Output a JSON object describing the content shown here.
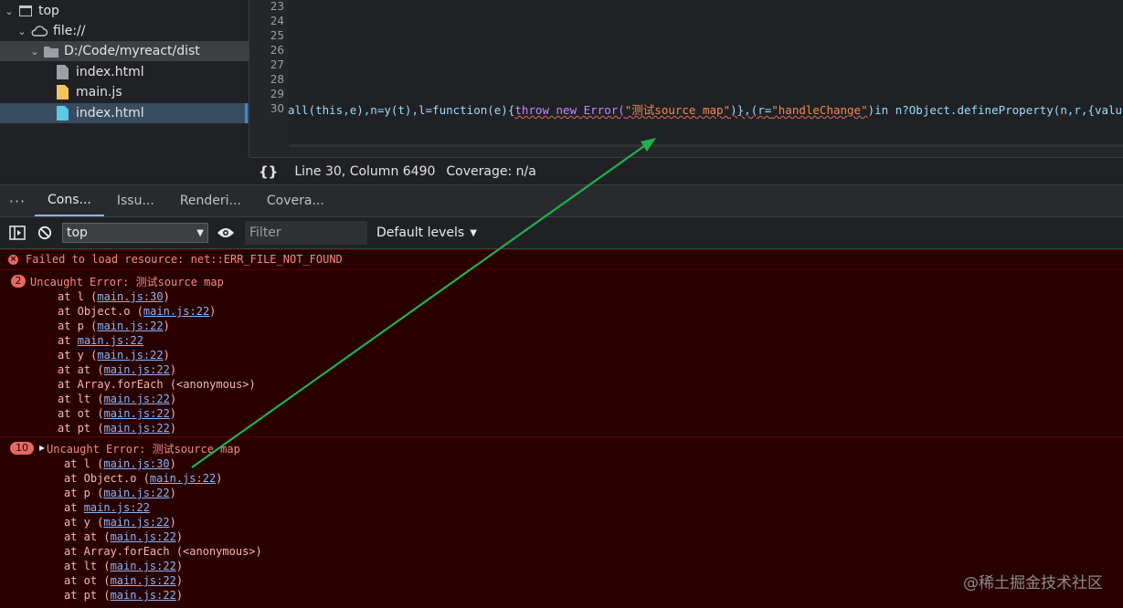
{
  "tree": {
    "items": [
      {
        "label": "top",
        "icon": "frame-icon",
        "chev": "⌄"
      },
      {
        "label": "file://",
        "icon": "cloud-icon",
        "chev": "⌄"
      },
      {
        "label": "D:/Code/myreact/dist",
        "icon": "folder-icon",
        "chev": "⌄"
      },
      {
        "label": "index.html",
        "icon": "file-icon"
      },
      {
        "label": "main.js",
        "icon": "js-file-icon"
      },
      {
        "label": "index.html",
        "icon": "html-file-icon"
      }
    ]
  },
  "editor": {
    "line_numbers": [
      "23",
      "24",
      "25",
      "26",
      "27",
      "28",
      "29",
      "30"
    ],
    "code_parts": [
      "all(this,e),n=y(t),l=function(e){",
      "throw new Error(",
      "\"测试source map\"",
      ")},(r=",
      "\"handleChange\"",
      ")in n?Object.defineProperty(n,r,{value"
    ]
  },
  "status": {
    "braces": "{}",
    "position": "Line 30, Column 6490",
    "coverage": "Coverage: n/a"
  },
  "tabs": {
    "more": "⋮",
    "items": [
      "Cons...",
      "Issu...",
      "Renderi...",
      "Covera..."
    ]
  },
  "toolbar": {
    "context": "top",
    "filter_placeholder": "Filter",
    "levels": "Default levels"
  },
  "console": {
    "msg1": "Failed to load resource: net::ERR_FILE_NOT_FOUND",
    "group1": {
      "badge": "2",
      "head": "Uncaught Error: 测试source map",
      "frames": [
        {
          "pre": "at l (",
          "link": "main.js:30",
          "post": ")"
        },
        {
          "pre": "at Object.o (",
          "link": "main.js:22",
          "post": ")"
        },
        {
          "pre": "at p (",
          "link": "main.js:22",
          "post": ")"
        },
        {
          "pre": "at ",
          "link": "main.js:22",
          "post": ""
        },
        {
          "pre": "at y (",
          "link": "main.js:22",
          "post": ")"
        },
        {
          "pre": "at at (",
          "link": "main.js:22",
          "post": ")"
        },
        {
          "pre": "at Array.forEach (<anonymous>)",
          "link": "",
          "post": ""
        },
        {
          "pre": "at lt (",
          "link": "main.js:22",
          "post": ")"
        },
        {
          "pre": "at ot (",
          "link": "main.js:22",
          "post": ")"
        },
        {
          "pre": "at pt (",
          "link": "main.js:22",
          "post": ")"
        }
      ]
    },
    "group2": {
      "badge": "10",
      "head": "Uncaught Error: 测试source map",
      "frames": [
        {
          "pre": "at l (",
          "link": "main.js:30",
          "post": ")"
        },
        {
          "pre": "at Object.o (",
          "link": "main.js:22",
          "post": ")"
        },
        {
          "pre": "at p (",
          "link": "main.js:22",
          "post": ")"
        },
        {
          "pre": "at ",
          "link": "main.js:22",
          "post": ""
        },
        {
          "pre": "at y (",
          "link": "main.js:22",
          "post": ")"
        },
        {
          "pre": "at at (",
          "link": "main.js:22",
          "post": ")"
        },
        {
          "pre": "at Array.forEach (<anonymous>)",
          "link": "",
          "post": ""
        },
        {
          "pre": "at lt (",
          "link": "main.js:22",
          "post": ")"
        },
        {
          "pre": "at ot (",
          "link": "main.js:22",
          "post": ")"
        },
        {
          "pre": "at pt (",
          "link": "main.js:22",
          "post": ")"
        }
      ]
    }
  },
  "watermark": "@稀土掘金技术社区",
  "colors": {
    "annotation_arrow": "#22b14c",
    "error_bg": "#290000",
    "link": "#8ab4f8"
  }
}
